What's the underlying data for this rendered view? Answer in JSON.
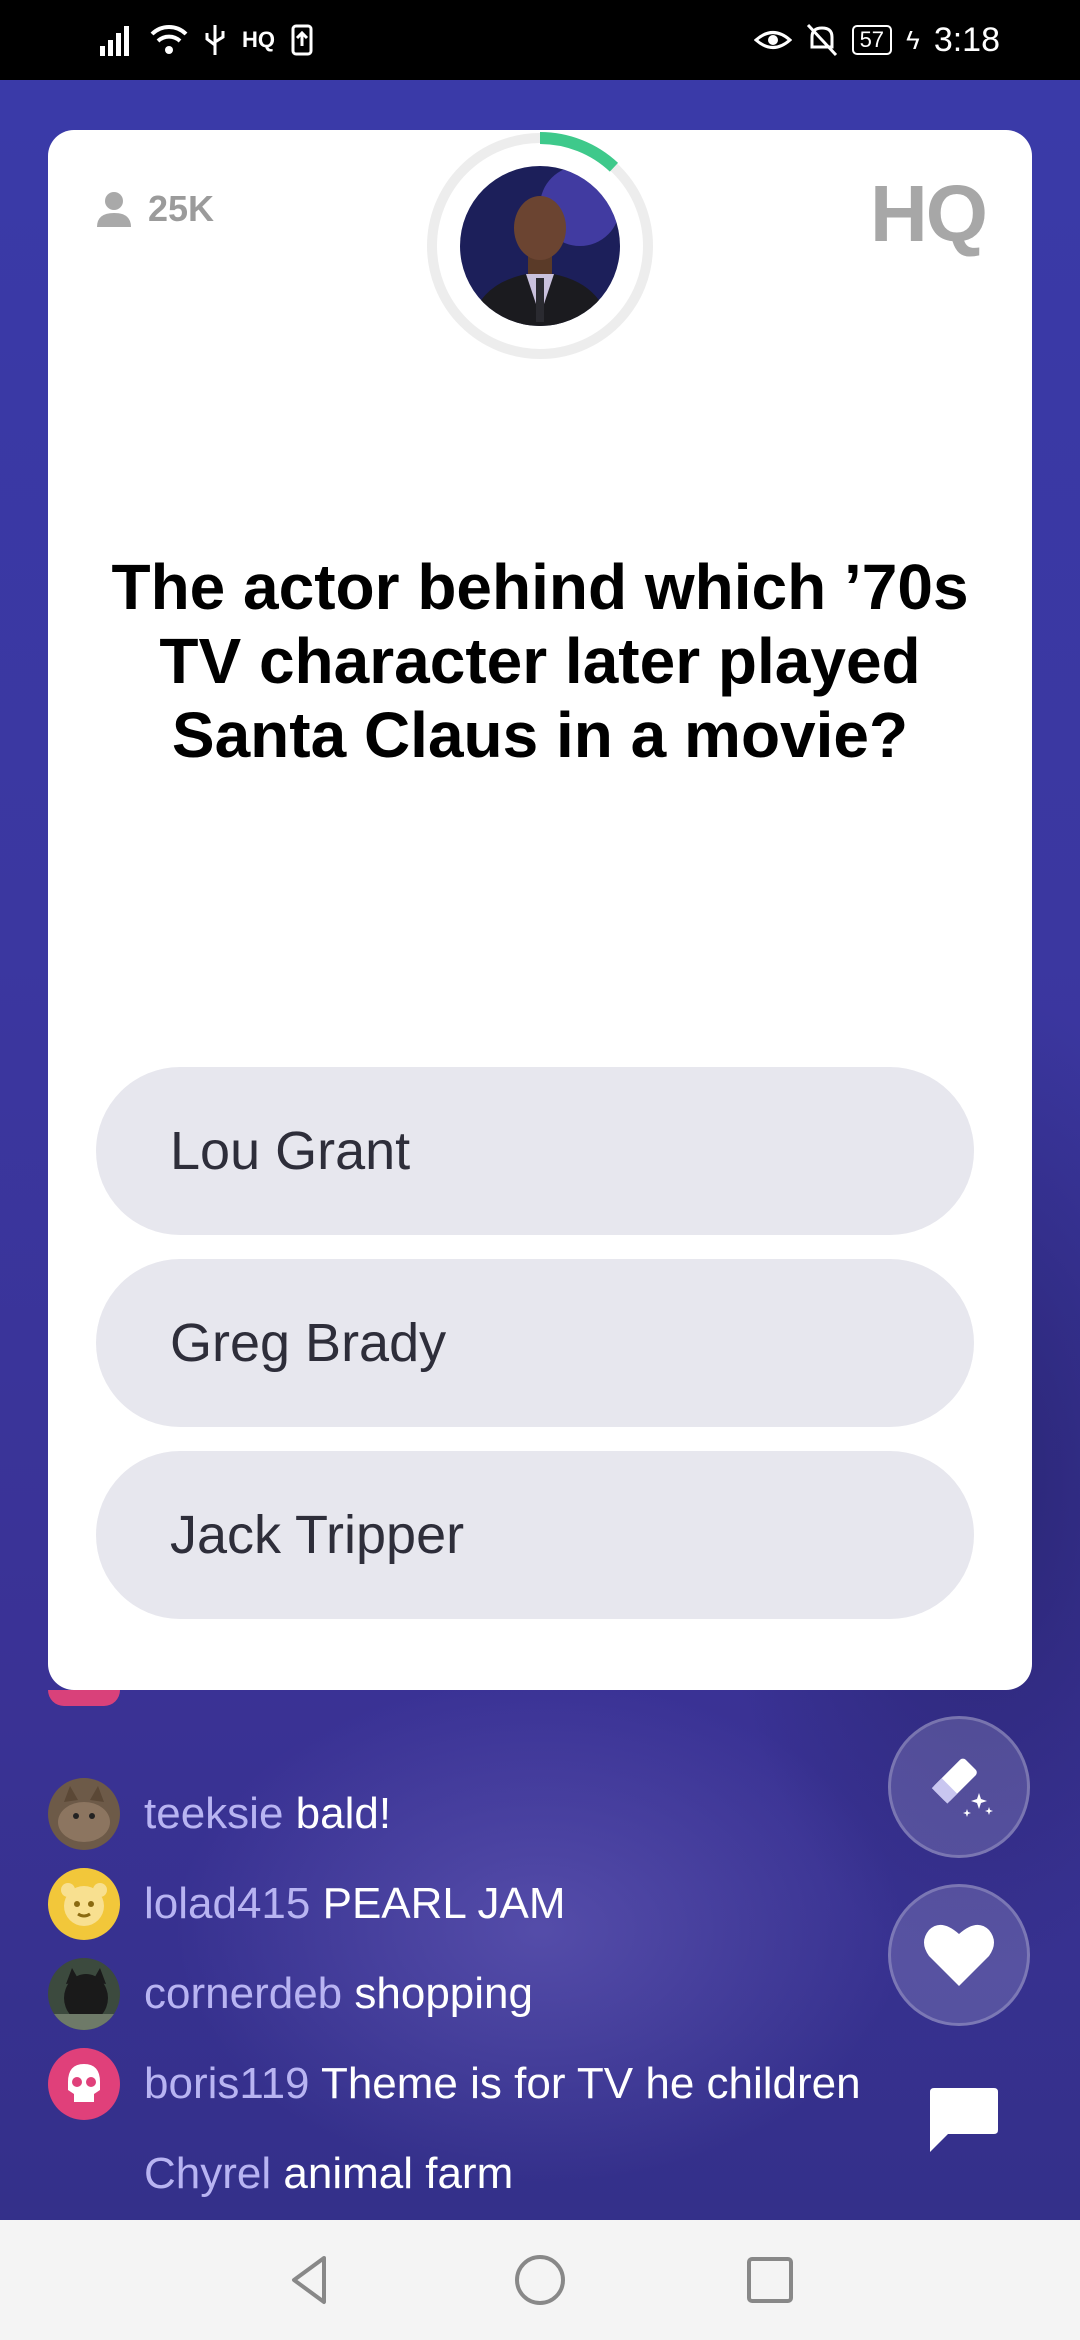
{
  "status_bar": {
    "network_label": "HQ",
    "battery": "57",
    "time": "3:18"
  },
  "card": {
    "player_count": "25K",
    "logo": "HQ",
    "timer_progress": 0.12,
    "question": "The actor behind which ’70s TV character later played Santa Claus in a movie?",
    "answers": [
      {
        "label": "Lou Grant"
      },
      {
        "label": "Greg Brady"
      },
      {
        "label": "Jack Tripper"
      }
    ]
  },
  "chat": [
    {
      "user": "teeksie",
      "message": "bald!",
      "avatar": "cat-photo-avatar"
    },
    {
      "user": "lolad415",
      "message": "PEARL JAM",
      "avatar": "yellow-face-avatar"
    },
    {
      "user": "cornerdeb",
      "message": "shopping",
      "avatar": "dog-photo-avatar"
    },
    {
      "user": "boris119",
      "message": "Theme is for TV he children",
      "avatar": "pink-skull-avatar"
    },
    {
      "user": "Chyrel",
      "message": "animal farm",
      "avatar": ""
    }
  ],
  "buttons": {
    "eraser_icon": "eraser-sparkle-icon",
    "heart_icon": "heart-icon",
    "comment_icon": "speech-bubble-icon"
  },
  "colors": {
    "background": "#3a37a3",
    "answer_fill": "#e7e7ee",
    "timer_green": "#3ec98b",
    "chat_username": "#b8b4f2"
  }
}
